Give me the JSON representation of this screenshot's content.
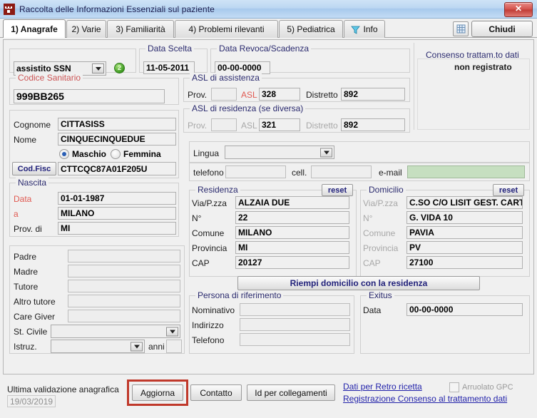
{
  "window": {
    "title": "Raccolta delle Informazioni Essenziali sul paziente",
    "icon": "castle-icon",
    "close_label": "✕"
  },
  "tabs": [
    {
      "label": "1) Anagrafe",
      "active": true
    },
    {
      "label": "2) Varie",
      "active": false
    },
    {
      "label": "3) Familiarità",
      "active": false
    },
    {
      "label": "4) Problemi rilevanti",
      "active": false
    },
    {
      "label": "5) Pediatrica",
      "active": false
    },
    {
      "label": "Info",
      "active": false,
      "icon": "funnel-icon"
    }
  ],
  "toolbar": {
    "grid_icon": "grid-icon",
    "close_button": "Chiudi"
  },
  "assistance": {
    "type_value": "assistito SSN",
    "badge": "2",
    "data_scelta_title": "Data Scelta",
    "data_scelta_value": "11-05-2011",
    "data_revoca_title": "Data Revoca/Scadenza",
    "data_revoca_value": "00-00-0000"
  },
  "consenso": {
    "title": "Consenso trattam.to dati",
    "status": "non registrato"
  },
  "codice_sanitario": {
    "title": "Codice Sanitario",
    "value": "999BB265"
  },
  "asl_assistenza": {
    "title": "ASL di assistenza",
    "prov_label": "Prov.",
    "prov_value": "",
    "asl_label": "ASL",
    "asl_value": "328",
    "distretto_label": "Distretto",
    "distretto_value": "892"
  },
  "asl_residenza": {
    "title": "ASL di residenza (se diversa)",
    "prov_label": "Prov.",
    "prov_value": "",
    "asl_label": "ASL",
    "asl_value": "321",
    "distretto_label": "Distretto",
    "distretto_value": "892"
  },
  "identity": {
    "cognome_label": "Cognome",
    "cognome_value": "CITTASISS",
    "nome_label": "Nome",
    "nome_value": "CINQUECINQUEDUE",
    "maschio_label": "Maschio",
    "femmina_label": "Femmina",
    "sesso_selected": "Maschio",
    "codfisc_button": "Cod.Fisc",
    "codfisc_value": "CTTCQC87A01F205U"
  },
  "nascita": {
    "title": "Nascita",
    "data_label": "Data",
    "data_value": "01-01-1987",
    "a_label": "a",
    "a_value": "MILANO",
    "prov_label": "Prov. di",
    "prov_value": "MI"
  },
  "family": {
    "padre_label": "Padre",
    "padre_value": "",
    "madre_label": "Madre",
    "madre_value": "",
    "tutore_label": "Tutore",
    "tutore_value": "",
    "altro_tutore_label": "Altro tutore",
    "altro_tutore_value": "",
    "care_giver_label": "Care Giver",
    "care_giver_value": "",
    "st_civile_label": "St. Civile",
    "st_civile_value": "",
    "istruz_label": "Istruz.",
    "istruz_value": "",
    "anni_label": "anni",
    "anni_value": ""
  },
  "contatti": {
    "lingua_label": "Lingua",
    "lingua_value": "",
    "telefono_label": "telefono",
    "telefono_value": "",
    "cell_label": "cell.",
    "cell_value": "",
    "email_label": "e-mail",
    "email_value": ""
  },
  "residenza": {
    "title": "Residenza",
    "reset_label": "reset",
    "via_label": "Via/P.zza",
    "via_value": "ALZAIA DUE",
    "numero_label": "N°",
    "numero_value": "22",
    "comune_label": "Comune",
    "comune_value": "MILANO",
    "provincia_label": "Provincia",
    "provincia_value": "MI",
    "cap_label": "CAP",
    "cap_value": "20127"
  },
  "domicilio": {
    "title": "Domicilio",
    "reset_label": "reset",
    "via_label": "Via/P.zza",
    "via_value": "C.SO C/O LISIT   GEST. CARTE",
    "numero_label": "N°",
    "numero_value": "G. VIDA 10",
    "comune_label": "Comune",
    "comune_value": "PAVIA",
    "provincia_label": "Provincia",
    "provincia_value": "PV",
    "cap_label": "CAP",
    "cap_value": "27100"
  },
  "riempi_button": "Riempi domicilio con la residenza",
  "persona_riferimento": {
    "title": "Persona di riferimento",
    "nominativo_label": "Nominativo",
    "nominativo_value": "",
    "indirizzo_label": "Indirizzo",
    "indirizzo_value": "",
    "telefono_label": "Telefono",
    "telefono_value": ""
  },
  "exitus": {
    "title": "Exitus",
    "data_label": "Data",
    "data_value": "00-00-0000"
  },
  "footer": {
    "ultima_validazione_label": "Ultima validazione anagrafica",
    "ultima_validazione_date": "19/03/2019",
    "aggiorna_button": "Aggiorna",
    "contatto_button": "Contatto",
    "id_collegamenti_button": "Id per collegamenti",
    "link_retro_ricetta": "Dati per Retro ricetta",
    "link_consenso": "Registrazione Consenso al trattamento dati",
    "arruolato_label": "Arruolato GPC",
    "arruolato_checked": false
  },
  "colors": {
    "accent_blue": "#2a2a6e",
    "link_blue": "#2222aa",
    "red_label": "#e05a52",
    "highlight_red": "#c0392b",
    "email_green": "#c6dfc0"
  }
}
